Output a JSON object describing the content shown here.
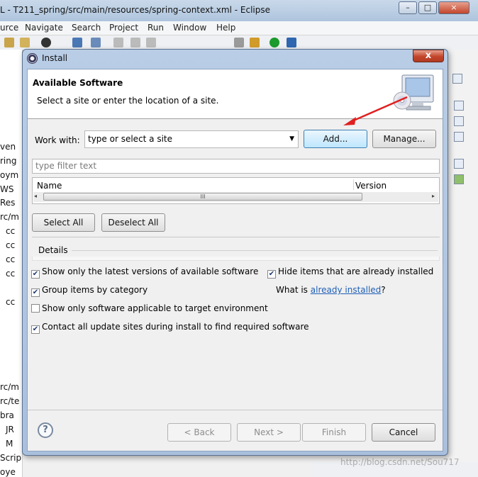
{
  "eclipse": {
    "title": "L - T211_spring/src/main/resources/spring-context.xml - Eclipse",
    "menu": [
      "urce",
      "Navigate",
      "Search",
      "Project",
      "Run",
      "Window",
      "Help"
    ],
    "window_controls": [
      "–",
      "□",
      "×"
    ],
    "left_strip": [
      "ven",
      "ring",
      "oym",
      "WS",
      "Res",
      "rc/m",
      "cc",
      "cc",
      "cc",
      "cc",
      "cc",
      "rc/m",
      "rc/te",
      "bra",
      "JR",
      "M",
      "Scrip",
      "oye"
    ],
    "watermark": "http://blog.csdn.net/Sou717"
  },
  "dialog": {
    "title": "Install",
    "close_label": "x",
    "header": {
      "title": "Available Software",
      "subtitle": "Select a site or enter the location of a site."
    },
    "work_with": {
      "label": "Work with:",
      "value": "type or select a site",
      "arrow": "▼"
    },
    "buttons": {
      "add": "Add...",
      "manage": "Manage...",
      "select_all": "Select All",
      "deselect_all": "Deselect All",
      "back": "< Back",
      "next": "Next >",
      "finish": "Finish",
      "cancel": "Cancel"
    },
    "filter": {
      "placeholder": "type filter text"
    },
    "table": {
      "columns": [
        "Name",
        "Version"
      ],
      "scroll_left": "◂",
      "scroll_right": "▸",
      "thumb_grip": "III"
    },
    "details_label": "Details",
    "options": {
      "latest": {
        "label": "Show only the latest versions of available software",
        "checked": true
      },
      "hide_installed": {
        "label": "Hide items that are already installed",
        "checked": true
      },
      "group": {
        "label": "Group items by category",
        "checked": true
      },
      "target": {
        "label": "Show only software applicable to target environment",
        "checked": false
      },
      "contact": {
        "label": "Contact all update sites during install to find required software",
        "checked": true
      }
    },
    "what_is": {
      "prefix": "What is ",
      "link": "already installed",
      "suffix": "?"
    },
    "help_icon": "?",
    "check_mark": "✔"
  },
  "colors": {
    "accent_link": "#1f5fb6",
    "annotation_arrow": "#e02020",
    "dialog_frame": "#b9cde6"
  }
}
